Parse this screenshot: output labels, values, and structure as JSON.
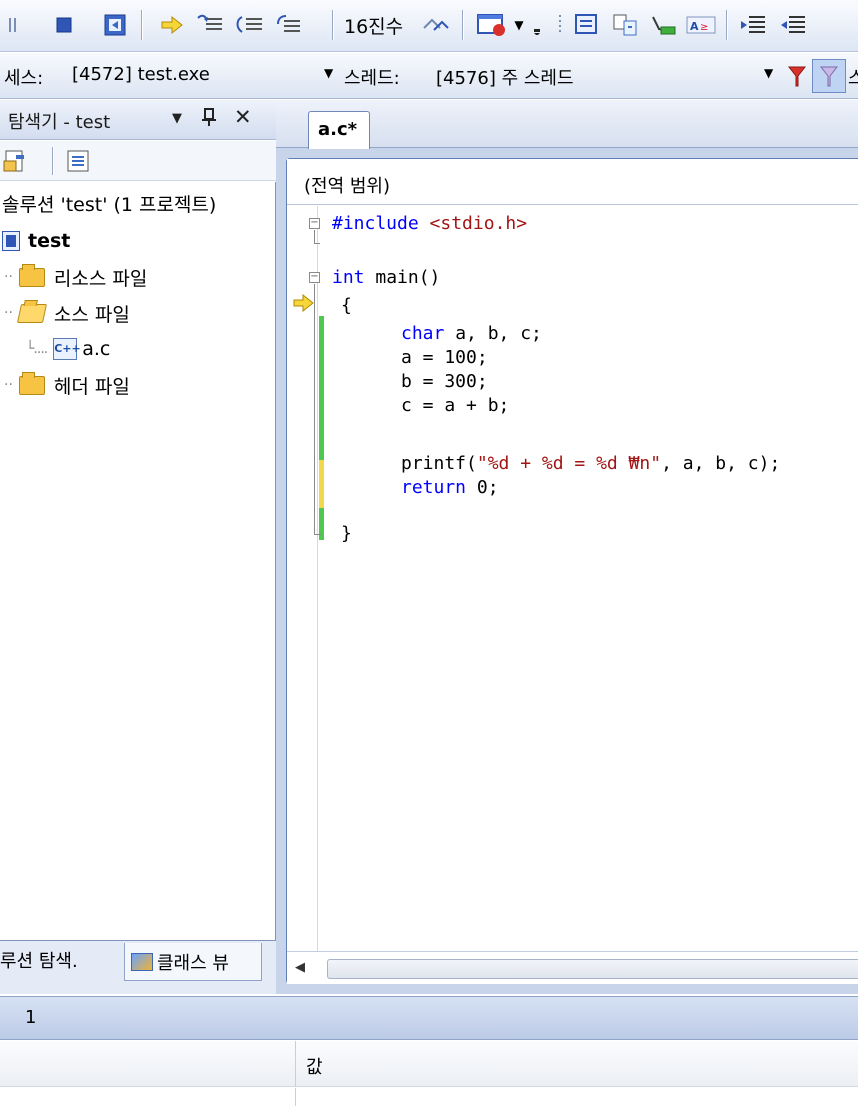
{
  "toolbar": {
    "hex_label": "16진수",
    "icons": [
      "pause-icon",
      "stop-icon",
      "restart-icon",
      "show-next-statement-icon",
      "step-into-icon",
      "step-over-icon",
      "step-out-icon",
      "hex-display-icon",
      "breakpoint-window-icon",
      "dropdown-icon",
      "toolbar-grip-icon",
      "output-icon",
      "find-icon",
      "watch-icon",
      "text-format-icon",
      "indent-icon"
    ]
  },
  "debug_location": {
    "process_label": "세스:",
    "process_value": "[4572] test.exe",
    "thread_label": "스레드:",
    "thread_value": "[4576] 주 스레드",
    "stack_label": "스"
  },
  "solution_explorer": {
    "title": "탐색기 - test",
    "solution_label": "솔루션 'test' (1 프로젝트)",
    "project": "test",
    "items": [
      {
        "label": "리소스 파일",
        "icon": "folder-icon"
      },
      {
        "label": "소스 파일",
        "icon": "folder-open-icon"
      },
      {
        "label": "a.c",
        "icon": "cpp-file-icon"
      },
      {
        "label": "헤더 파일",
        "icon": "folder-icon"
      }
    ],
    "tabs": {
      "solution": "루션 탐색.",
      "class_view": "클래스 뷰"
    }
  },
  "editor": {
    "tab_label": "a.c*",
    "scope": "(전역 범위)",
    "lines": [
      "#include <stdio.h>",
      "",
      "int main()",
      "{",
      "    char a, b, c;",
      "    a = 100;",
      "    b = 300;",
      "    c = a + b;",
      "",
      "    printf(\"%d + %d = %d ₩n\", a, b, c);",
      "    return 0;",
      "}"
    ]
  },
  "bottom_panel": {
    "title": "1",
    "value_column": "값"
  },
  "colors": {
    "keyword": "#0000ff",
    "string": "#a31515",
    "changed_saved": "#4fc84f",
    "changed_unsaved": "#f0d84a"
  }
}
